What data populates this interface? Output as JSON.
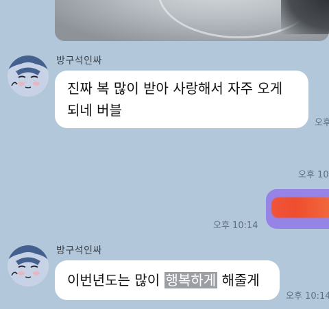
{
  "messages": [
    {
      "sender": "방구석인싸",
      "text_line1": "진짜 복 많이 받아 사랑해서 자주 오게",
      "text_line2": "되네 버블",
      "time": "오후"
    },
    {
      "direction": "outgoing",
      "time_above": "오후 10:",
      "time": "오후 10:14"
    },
    {
      "sender": "방구석인싸",
      "text_before": "이번년도는 많이 ",
      "text_highlight": "행복하게",
      "text_after": " 해줄게",
      "time": "오후 10:14"
    }
  ],
  "colors": {
    "background": "#b2c7da",
    "incoming_bubble": "#ffffff",
    "outgoing_bubble": "#9584e6",
    "redaction": "#ef4e2e"
  },
  "icons": {
    "avatar": "sleepy-face-avatar"
  }
}
